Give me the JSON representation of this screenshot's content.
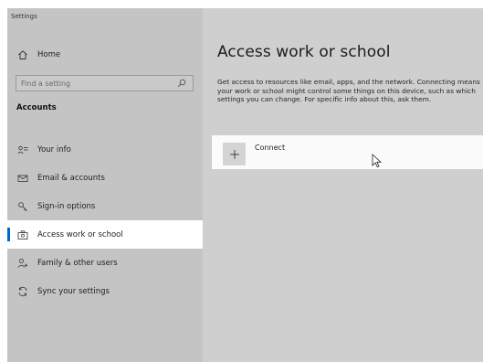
{
  "window": {
    "app_title": "Settings"
  },
  "sidebar": {
    "home": {
      "label": "Home",
      "icon": "home-icon"
    },
    "search": {
      "placeholder": "Find a setting",
      "value": "",
      "icon": "search-icon"
    },
    "section_title": "Accounts",
    "items": [
      {
        "label": "Your info",
        "icon": "person-lines-icon",
        "selected": false
      },
      {
        "label": "Email & accounts",
        "icon": "mail-icon",
        "selected": false
      },
      {
        "label": "Sign-in options",
        "icon": "key-icon",
        "selected": false
      },
      {
        "label": "Access work or school",
        "icon": "briefcase-icon",
        "selected": true
      },
      {
        "label": "Family & other users",
        "icon": "person-plus-icon",
        "selected": false
      },
      {
        "label": "Sync your settings",
        "icon": "sync-icon",
        "selected": false
      }
    ]
  },
  "main": {
    "title": "Access work or school",
    "description": "Get access to resources like email, apps, and the network. Connecting means your work or school might control some things on this device, such as which settings you can change. For specific info about this, ask them.",
    "connect": {
      "label": "Connect",
      "icon": "plus-icon"
    }
  },
  "colors": {
    "accent": "#0067c0",
    "sidebar_bg": "#c4c4c4",
    "main_bg": "#cfcfcf",
    "selected_bg": "#ffffff"
  }
}
